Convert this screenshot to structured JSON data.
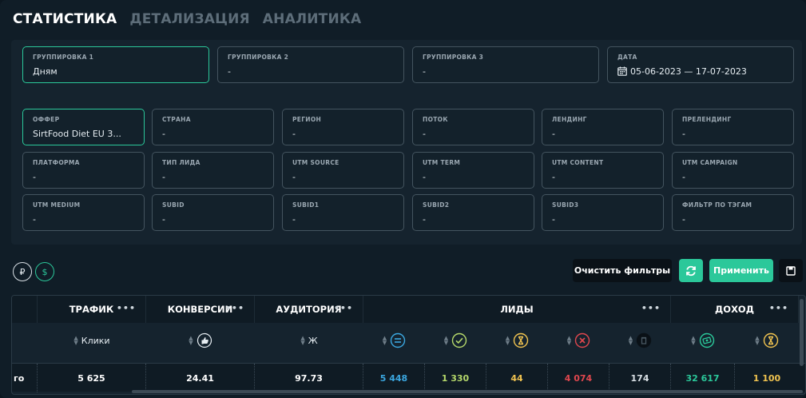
{
  "tabs": [
    "СТАТИСТИКА",
    "ДЕТАЛИЗАЦИЯ",
    "АНАЛИТИКА"
  ],
  "grouping": [
    {
      "label": "ГРУППИРОВКА 1",
      "value": "Дням"
    },
    {
      "label": "ГРУППИРОВКА 2",
      "value": "-"
    },
    {
      "label": "ГРУППИРОВКА 3",
      "value": "-"
    },
    {
      "label": "ДАТА",
      "value": "05-06-2023 — 17-07-2023"
    }
  ],
  "filters": [
    {
      "label": "ОФФЕР",
      "value": "SirtFood Diet EU 3..."
    },
    {
      "label": "СТРАНА",
      "value": "-"
    },
    {
      "label": "РЕГИОН",
      "value": "-"
    },
    {
      "label": "ПОТОК",
      "value": "-"
    },
    {
      "label": "ЛЕНДИНГ",
      "value": "-"
    },
    {
      "label": "ПРЕЛЕНДИНГ",
      "value": "-"
    },
    {
      "label": "ПЛАТФОРМА",
      "value": "-"
    },
    {
      "label": "ТИП ЛИДА",
      "value": "-"
    },
    {
      "label": "UTM SOURCE",
      "value": "-"
    },
    {
      "label": "UTM TERM",
      "value": "-"
    },
    {
      "label": "UTM CONTENT",
      "value": "-"
    },
    {
      "label": "UTM CAMPAIGN",
      "value": "-"
    },
    {
      "label": "UTM MEDIUM",
      "value": "-"
    },
    {
      "label": "SUBID",
      "value": "-"
    },
    {
      "label": "SUBID1",
      "value": "-"
    },
    {
      "label": "SUBID2",
      "value": "-"
    },
    {
      "label": "SUBID3",
      "value": "-"
    },
    {
      "label": "ФИЛЬТР ПО ТЭГАМ",
      "value": "-"
    }
  ],
  "currency": {
    "rub": "₽",
    "usd": "$"
  },
  "actions": {
    "clear": "Очистить фильтры",
    "apply": "Применить"
  },
  "table": {
    "groups": {
      "traffic": "ТРАФИК",
      "conversions": "КОНВЕРСИИ",
      "audience": "АУДИТОРИЯ",
      "leads": "ЛИДЫ",
      "income": "ДОХОД"
    },
    "subheaders": {
      "clicks": "Клики",
      "audience_gender": "Ж"
    },
    "row_label": "го",
    "row": {
      "clicks": "5 625",
      "conversions": "24.41",
      "audience": "97.73",
      "leads_total": "5 448",
      "leads_approved": "1 330",
      "leads_hold": "44",
      "leads_rejected": "4 074",
      "leads_trash": "174",
      "income_total": "32 617",
      "income_hold": "1 100"
    },
    "colors": {
      "blue": "#3ba7e0",
      "green": "#b5d86b",
      "yellow": "#f0c350",
      "red": "#e0474e",
      "gray": "#d9e0e5",
      "teal": "#2bc89a"
    }
  }
}
